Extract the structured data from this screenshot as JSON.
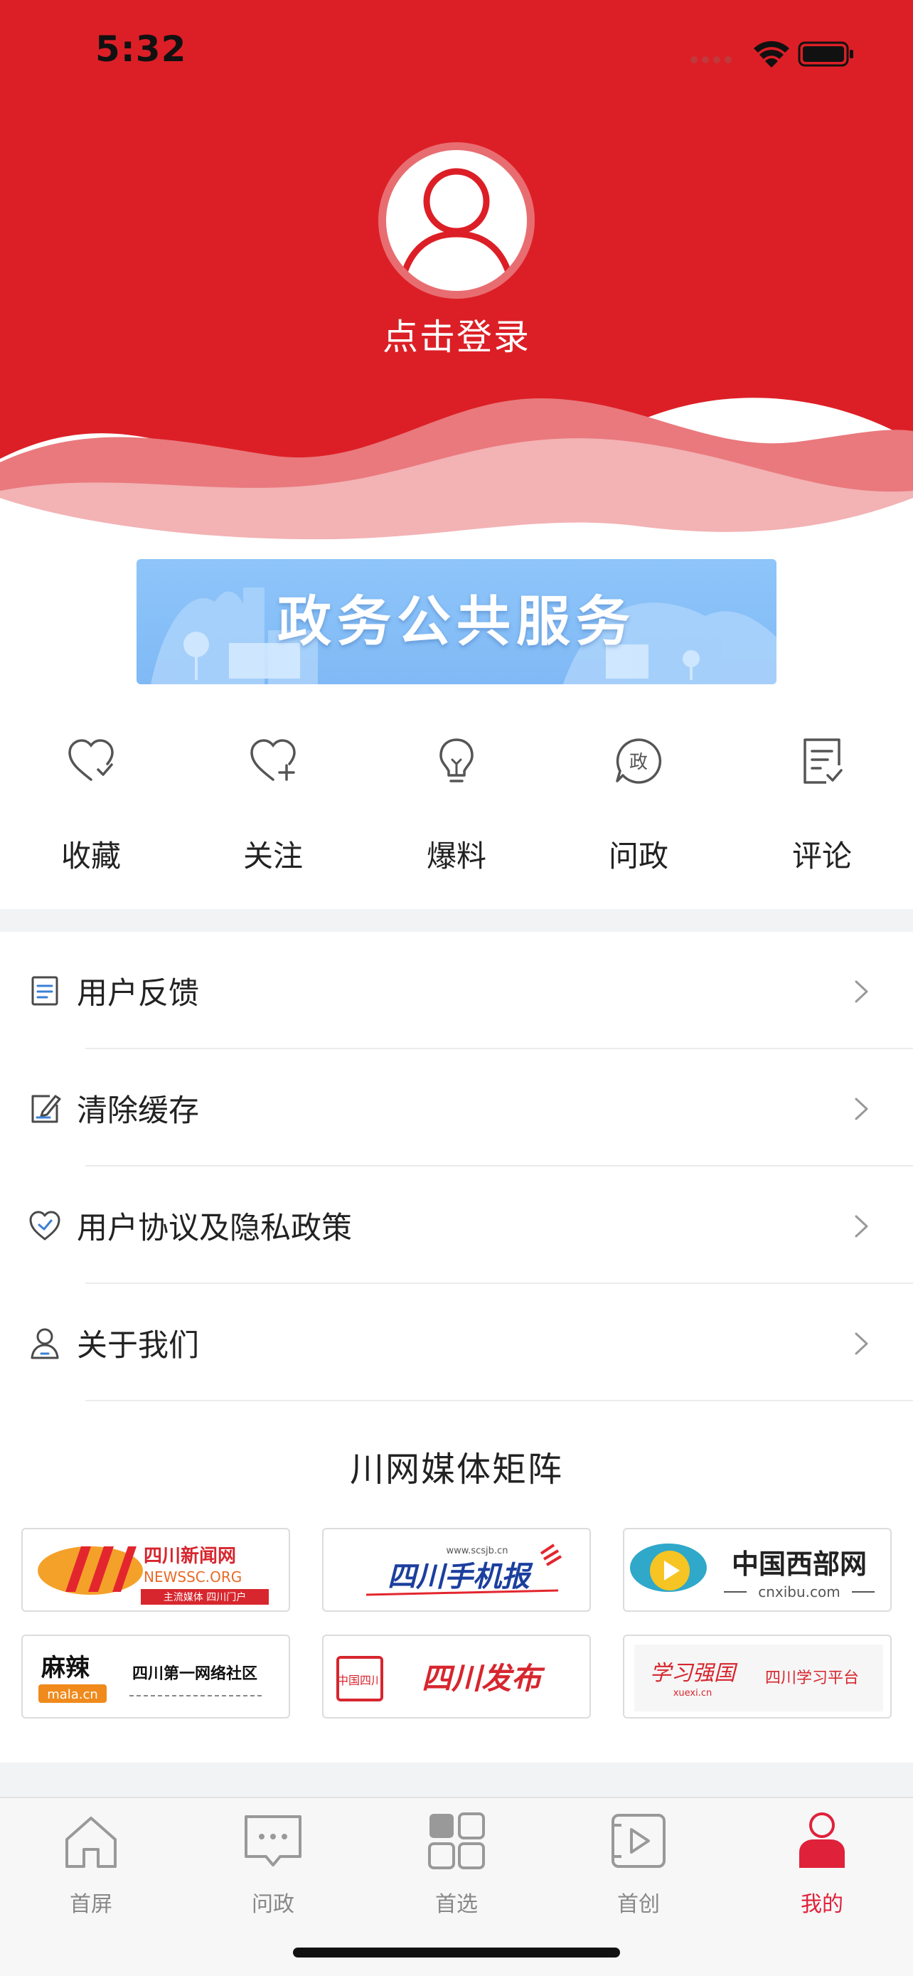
{
  "status_bar": {
    "time": "5:32"
  },
  "header": {
    "login_label": "点击登录",
    "color": "#dc1f26"
  },
  "banner": {
    "label": "政务公共服务"
  },
  "quick_actions": [
    {
      "label": "收藏",
      "icon": "heart-check-icon"
    },
    {
      "label": "关注",
      "icon": "heart-plus-icon"
    },
    {
      "label": "爆料",
      "icon": "lightbulb-icon"
    },
    {
      "label": "问政",
      "icon": "zheng-chat-icon",
      "icon_text": "政"
    },
    {
      "label": "评论",
      "icon": "comment-doc-icon"
    }
  ],
  "menu": [
    {
      "label": "用户反馈",
      "icon": "document-icon"
    },
    {
      "label": "清除缓存",
      "icon": "edit-icon"
    },
    {
      "label": "用户协议及隐私政策",
      "icon": "heart-shield-icon"
    },
    {
      "label": "关于我们",
      "icon": "user-icon"
    }
  ],
  "media_matrix": {
    "title": "川网媒体矩阵",
    "logos": [
      {
        "name": "四川新闻网",
        "sub": "NEWSSC.ORG",
        "tag": "主流媒体 四川门户"
      },
      {
        "name": "四川手机报",
        "sub": "www.scsjb.cn"
      },
      {
        "name": "中国西部网",
        "sub": "cnxibu.com"
      },
      {
        "name": "四川第一网络社区",
        "sub": "麻辣",
        "tag": "mala.cn"
      },
      {
        "name": "四川发布",
        "sub": "中国四川"
      },
      {
        "name": "四川学习平台",
        "sub": "学习强国",
        "tag": "xuexi.cn"
      }
    ]
  },
  "tabbar": {
    "active": "我的",
    "active_color": "#e0213a",
    "tabs": [
      {
        "label": "首屏",
        "icon": "home-icon"
      },
      {
        "label": "问政",
        "icon": "chat-bubble-icon"
      },
      {
        "label": "首选",
        "icon": "grid-icon"
      },
      {
        "label": "首创",
        "icon": "video-play-icon"
      },
      {
        "label": "我的",
        "icon": "profile-icon"
      }
    ]
  }
}
